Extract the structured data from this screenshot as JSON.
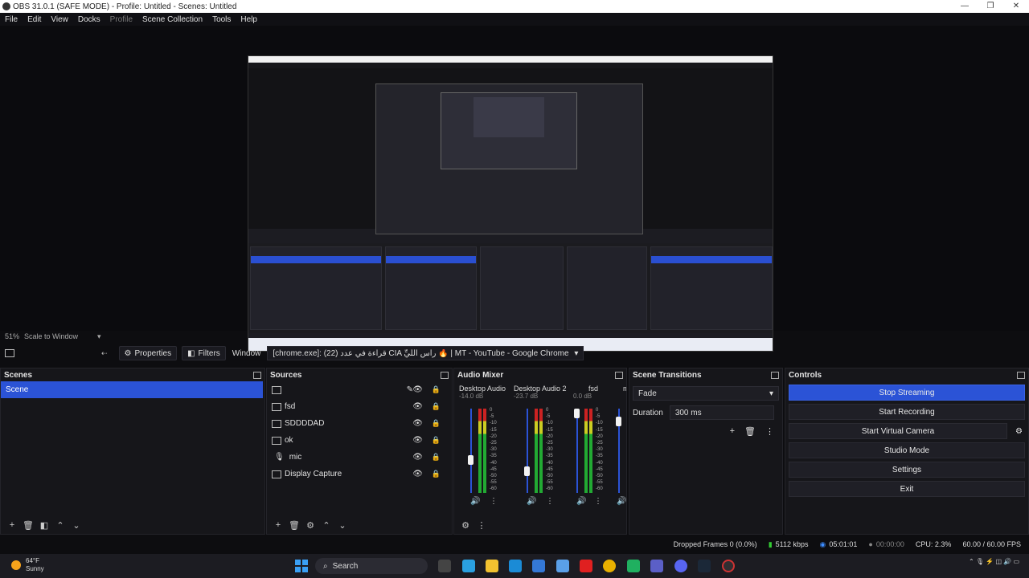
{
  "window": {
    "title": "OBS 31.0.1 (SAFE MODE) - Profile: Untitled - Scenes: Untitled",
    "controls": [
      "—",
      "❐",
      "✕"
    ]
  },
  "menu": [
    "File",
    "Edit",
    "View",
    "Docks",
    "Profile",
    "Scene Collection",
    "Tools",
    "Help"
  ],
  "preview": {
    "zoom": "51%",
    "scale_mode": "Scale to Window"
  },
  "context_bar": {
    "properties": "Properties",
    "filters": "Filters",
    "window_label": "Window",
    "window_value": "[chrome.exe]: (22) قراءة في عدد CIA رأس اللِّيِّ 🔥 | MT - YouTube - Google Chrome"
  },
  "scenes": {
    "title": "Scenes",
    "items": [
      "Scene"
    ],
    "selected": 0
  },
  "sources": {
    "title": "Sources",
    "items": [
      {
        "name": "",
        "type": "window"
      },
      {
        "name": "fsd",
        "type": "window"
      },
      {
        "name": "SDDDDAD",
        "type": "window"
      },
      {
        "name": "ok",
        "type": "window"
      },
      {
        "name": "mic",
        "type": "mic"
      },
      {
        "name": "Display Capture",
        "type": "display"
      }
    ]
  },
  "mixer": {
    "title": "Audio Mixer",
    "channels": [
      {
        "name": "Desktop Audio",
        "db": "-14.0 dB"
      },
      {
        "name": "Desktop Audio 2",
        "db": "-23.7 dB"
      },
      {
        "name": "fsd",
        "db": "0.0 dB"
      },
      {
        "name": "m",
        "db": ""
      }
    ],
    "scale": [
      "0",
      "-5",
      "-10",
      "-15",
      "-20",
      "-25",
      "-30",
      "-35",
      "-40",
      "-45",
      "-50",
      "-55",
      "-60"
    ]
  },
  "transitions": {
    "title": "Scene Transitions",
    "selected": "Fade",
    "duration_label": "Duration",
    "duration_value": "300 ms"
  },
  "controls": {
    "title": "Controls",
    "stop_streaming": "Stop Streaming",
    "start_recording": "Start Recording",
    "start_virtual_camera": "Start Virtual Camera",
    "studio_mode": "Studio Mode",
    "settings": "Settings",
    "exit": "Exit"
  },
  "status": {
    "dropped": "Dropped Frames 0 (0.0%)",
    "bitrate": "5112 kbps",
    "stream_time": "05:01:01",
    "rec_time": "00:00:00",
    "cpu": "CPU: 2.3%",
    "fps": "60.00 / 60.00 FPS"
  },
  "taskbar": {
    "temp": "64°F",
    "weather": "Sunny",
    "search": "Search"
  }
}
